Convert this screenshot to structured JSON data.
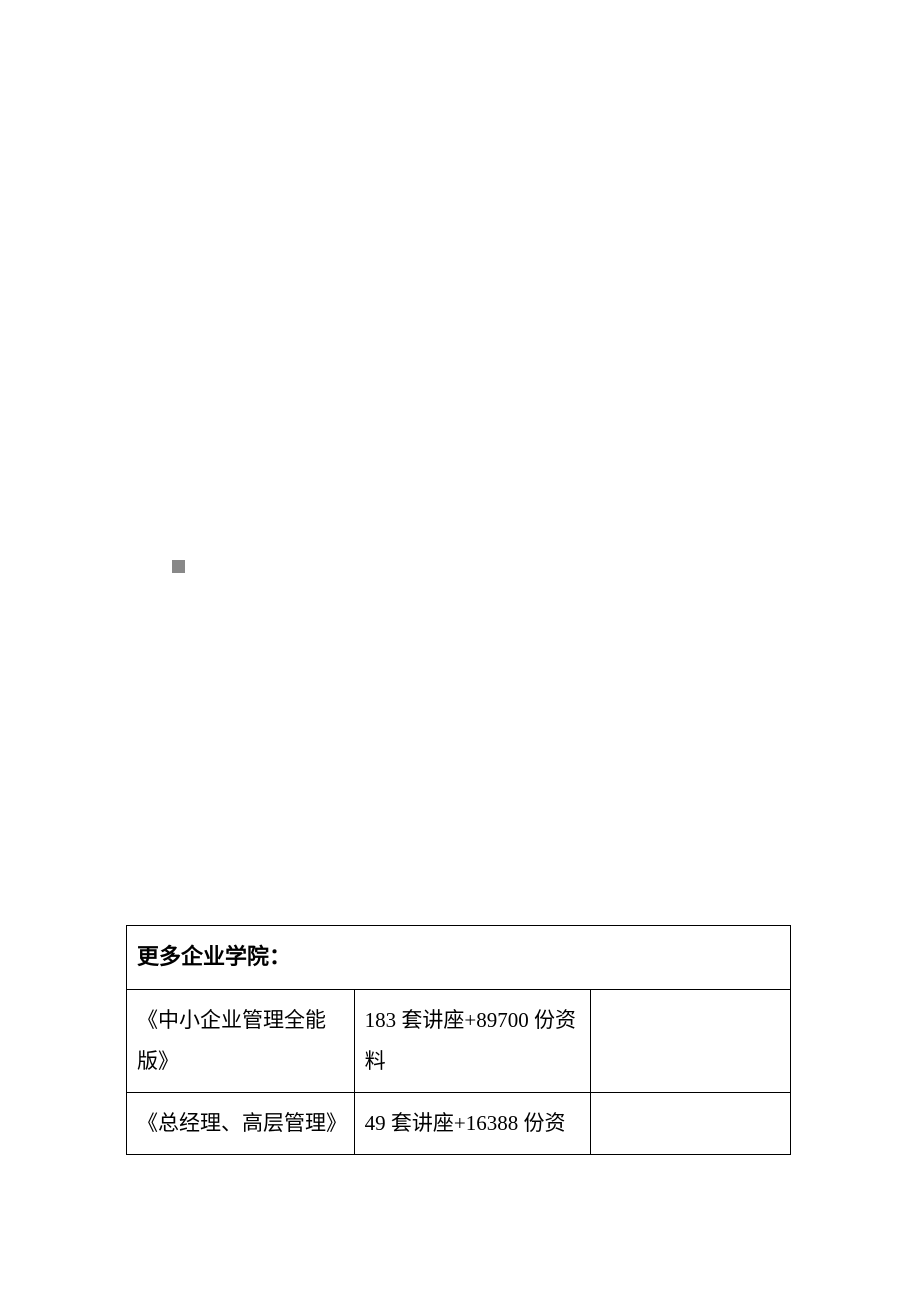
{
  "table": {
    "header": "更多企业学院：",
    "rows": [
      {
        "title": "《中小企业管理全能版》",
        "desc": "183 套讲座+89700 份资料",
        "extra": ""
      },
      {
        "title": "《总经理、高层管理》",
        "desc": "49 套讲座+16388 份资",
        "extra": ""
      }
    ]
  }
}
